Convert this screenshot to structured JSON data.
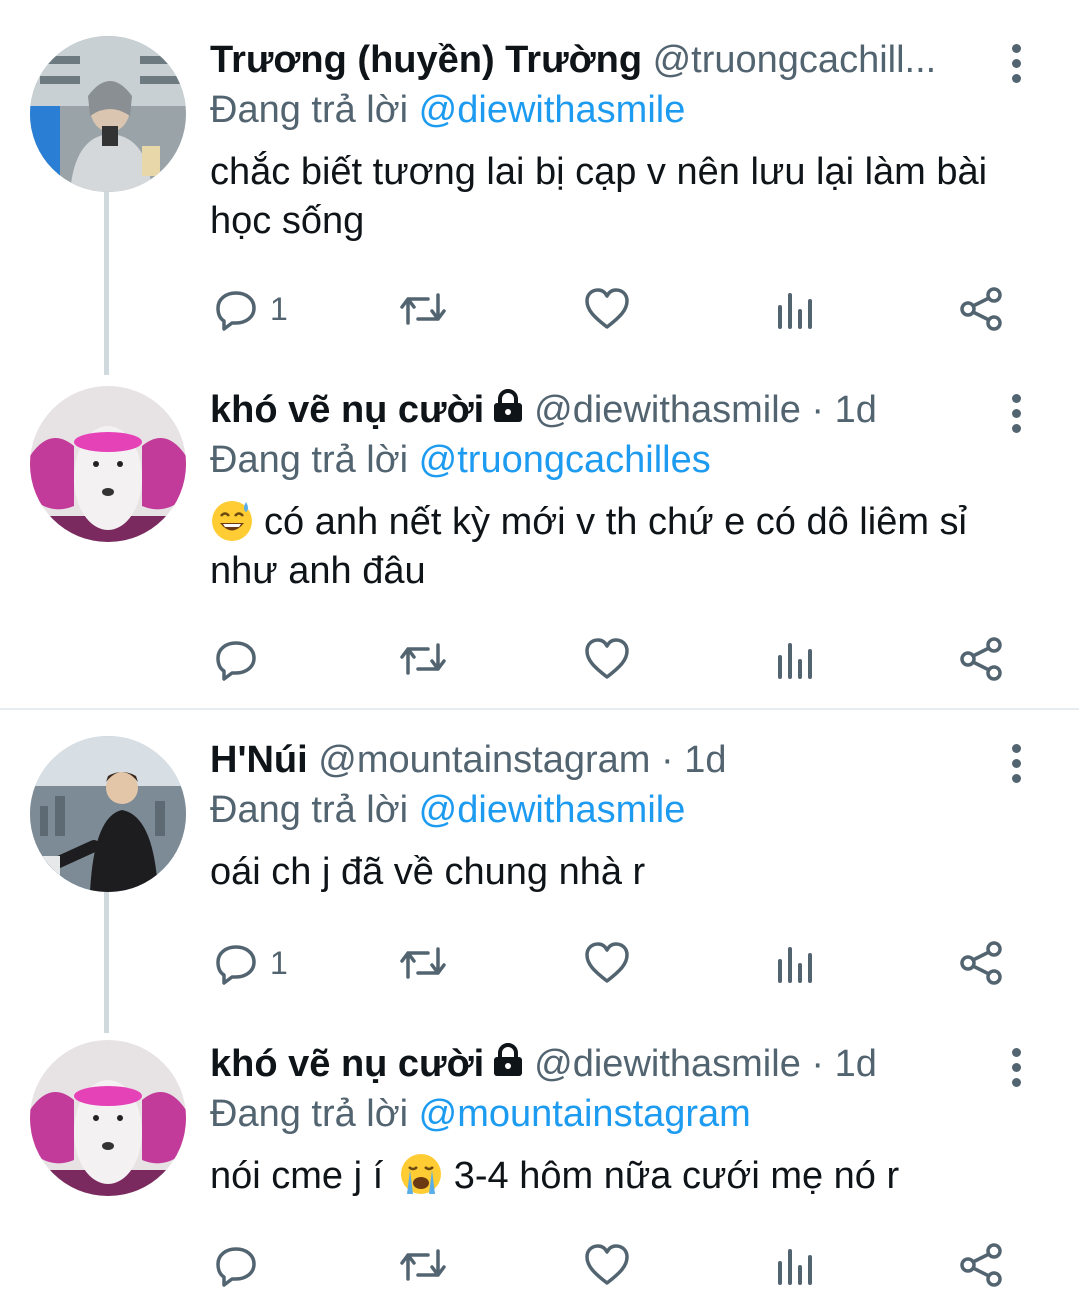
{
  "reply_prefix": "Đang trả lời",
  "tweets": [
    {
      "name": "Trương (huyền) Trường",
      "handle": "@truongcachill...",
      "time": "",
      "locked": false,
      "reply_to": "@diewithasmile",
      "text": "chắc biết tương lai bị cạp v nên lưu lại làm bài học sống",
      "emoji": "",
      "reply_count": "1"
    },
    {
      "name": "khó vẽ nụ cười",
      "handle": "@diewithasmile",
      "time": "· 1d",
      "locked": true,
      "reply_to": "@truongcachilles",
      "text": "có anh nết kỳ mới v th chứ e có dô liêm sỉ như anh đâu",
      "emoji": "sweat-smile",
      "reply_count": ""
    },
    {
      "name": "H'Núi",
      "handle": "@mountainstagram",
      "time": "· 1d",
      "locked": false,
      "reply_to": "@diewithasmile",
      "text": "oái ch j đã về chung nhà r",
      "emoji": "",
      "reply_count": "1"
    },
    {
      "name": "khó vẽ nụ cười",
      "handle": "@diewithasmile",
      "time": "· 1d",
      "locked": true,
      "reply_to": "@mountainstagram",
      "text_before": "nói cme j í",
      "emoji": "crying-face",
      "text_after": "3-4 hôm nữa cưới mẹ nó r",
      "reply_count": ""
    }
  ],
  "colors": {
    "link": "#1d9bf0",
    "secondary": "#536471",
    "thread_line": "#cfd9de"
  }
}
